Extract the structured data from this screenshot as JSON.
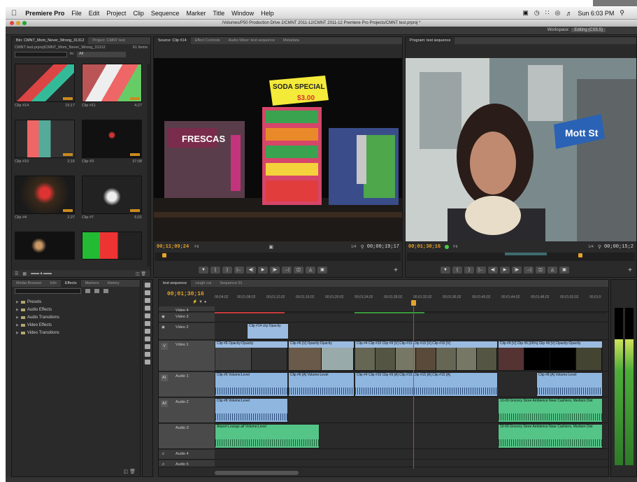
{
  "menubar": {
    "app": "Premiere Pro",
    "items": [
      "File",
      "Edit",
      "Project",
      "Clip",
      "Sequence",
      "Marker",
      "Title",
      "Window",
      "Help"
    ],
    "clock": "Sun 6:03 PM"
  },
  "window": {
    "title": "/Volumes/P50 Production Drive 2/CMNT 2011-12/CMNT 2011-12 Premiere Pro Projects/CMNT test.prproj *"
  },
  "workspace": {
    "label": "Workspace:",
    "value": "Editing (CS5.5)"
  },
  "project": {
    "tabs": [
      "Bin: CMNT_Mom_Never_Wrong_31312",
      "Project: CMNT test"
    ],
    "path": "CMNT test.prproj\\CMNT_Mom_Never_Wrong_31312",
    "count": "61 Items",
    "in_label": "In:",
    "in_value": "All",
    "clips": [
      {
        "name": "Clip #14",
        "dur": "19;17"
      },
      {
        "name": "Clip #11",
        "dur": "4;27"
      },
      {
        "name": "Clip #10",
        "dur": "2;15"
      },
      {
        "name": "Clip #3",
        "dur": "37;08"
      },
      {
        "name": "Clip #4",
        "dur": "2;27"
      },
      {
        "name": "Clip #7",
        "dur": "6;01"
      },
      {
        "name": "",
        "dur": ""
      },
      {
        "name": "",
        "dur": ""
      }
    ]
  },
  "source": {
    "tabs": [
      "Source: Clip #14",
      "Effect Controls",
      "Audio Mixer: test sequence",
      "Metadata"
    ],
    "tc_in": "00;11;09;24",
    "fit": "Fit",
    "zoom": "1/4",
    "tc_out": "00;00;19;17",
    "sign": "SODA SPECIAL",
    "price": "$3.00"
  },
  "program": {
    "tabs": [
      "Program: test sequence"
    ],
    "tc_in": "00;01;30;16",
    "fit": "Fit",
    "zoom": "1/4",
    "tc_out": "00;00;15;2",
    "street_sign": "Mott St"
  },
  "effects": {
    "tabs": [
      "Media Browser",
      "Info",
      "Effects",
      "Markers",
      "History"
    ],
    "tree": [
      "Presets",
      "Audio Effects",
      "Audio Transitions",
      "Video Effects",
      "Video Transitions"
    ]
  },
  "timeline": {
    "tabs": [
      "test sequence",
      "rough cut",
      "Sequence 01"
    ],
    "timecode": "00;01;30;16",
    "ticks": [
      "00;04;02",
      "00;01;08;02",
      "00;01;12;02",
      "00;01;16;02",
      "00;01;20;02",
      "00;01;24;02",
      "00;01;28;02",
      "00;01;32;02",
      "00;01;36;02",
      "00;01;40;02",
      "00;01;44;02",
      "00;01;48;02",
      "00;01;52;02",
      "00;01;5"
    ],
    "tracks": {
      "video4": "Video 4",
      "video3": "Video 3",
      "video2": "Video 2",
      "video1": "Video 1",
      "audio1": "Audio 1",
      "audio2": "Audio 2",
      "audio3": "Audio 3",
      "audio4": "Audio 4",
      "audio5": "Audio 5"
    },
    "target_v": "V",
    "target_a1": "A1",
    "target_a2": "A2",
    "clips": {
      "v2": "Clip #14 city:Opacity",
      "v1a": "Clip #6 Opacity:Opacity",
      "v1b": "Clip #6 [V] Opacity:Opacity",
      "v1c": "Clip #4 Clip #10 Clip #9 [V] Clip #15 Clip #15 [V] Clip #15 [V]",
      "v1d": "Clip #9 [V] Clip #5 [26%] Clip #8 [V] Opacity:Opacity",
      "a1a": "Clip #6 Volume:Level",
      "a1b": "Clip #6 [A] Volume:Level",
      "a1c": "Clip #4 Clip #10 Clip #9 [A] Clip #15 Clip #15 [A] Clip #15 [A]",
      "a1d": "Clip #8 [A] Volume:Level",
      "a2a": "Clip #8 Volume:Level",
      "a2b": "10-09 Grocery Store Ambience Near Cashiers, Medium Dist",
      "a3a": "Airport Lounge.aif Volume:Level",
      "a3b": "10-09 Grocery Store Ambience Near Cashiers, Medium Dist"
    }
  }
}
